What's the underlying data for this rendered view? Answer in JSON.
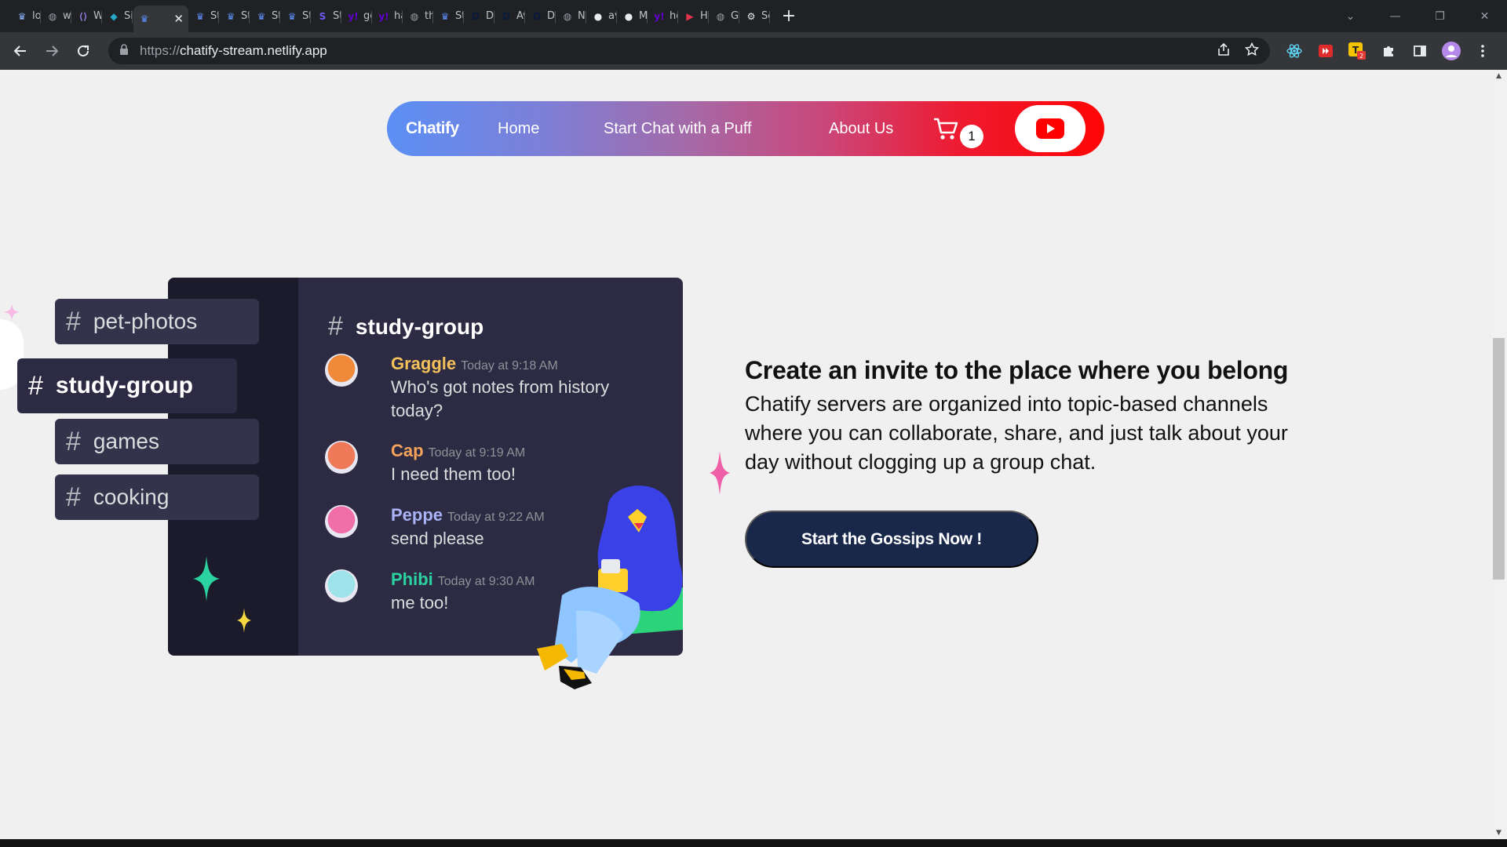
{
  "browser": {
    "tabs": [
      {
        "label": "lo",
        "icon": "crown-icon",
        "color": "#8ab4f8"
      },
      {
        "label": "wv",
        "icon": "globe-icon",
        "color": "#9aa0a6"
      },
      {
        "label": "W",
        "icon": "brackets-icon",
        "color": "#8a7bd8"
      },
      {
        "label": "Sit",
        "icon": "diamond-icon",
        "color": "#26a8c8"
      },
      {
        "label": "",
        "icon": "crown-icon",
        "color": "#5c8ff5",
        "active": true
      },
      {
        "label": "Str",
        "icon": "crown-icon",
        "color": "#5c8ff5"
      },
      {
        "label": "Str",
        "icon": "crown-icon",
        "color": "#5c8ff5"
      },
      {
        "label": "Str",
        "icon": "crown-icon",
        "color": "#5c8ff5"
      },
      {
        "label": "Str",
        "icon": "crown-icon",
        "color": "#5c8ff5"
      },
      {
        "label": "Str",
        "icon": "s-icon",
        "color": "#6f5af3"
      },
      {
        "label": "ge",
        "icon": "yahoo-icon",
        "color": "#6001d2"
      },
      {
        "label": "ha",
        "icon": "yahoo-icon",
        "color": "#6001d2"
      },
      {
        "label": "th",
        "icon": "globe-icon",
        "color": "#9aa0a6"
      },
      {
        "label": "Str",
        "icon": "crown-icon",
        "color": "#5c8ff5"
      },
      {
        "label": "De",
        "icon": "d-icon",
        "color": "#0a1a3a"
      },
      {
        "label": "Av",
        "icon": "d-icon",
        "color": "#0a1a3a"
      },
      {
        "label": "De",
        "icon": "d-icon",
        "color": "#0a1a3a"
      },
      {
        "label": "Ne",
        "icon": "globe-icon",
        "color": "#9aa0a6"
      },
      {
        "label": "av",
        "icon": "github-icon",
        "color": "#e8eaed"
      },
      {
        "label": "M",
        "icon": "github-icon",
        "color": "#e8eaed"
      },
      {
        "label": "ho",
        "icon": "yahoo-icon",
        "color": "#6001d2"
      },
      {
        "label": "Ho",
        "icon": "play-icon",
        "color": "#e8344e"
      },
      {
        "label": "Gi",
        "icon": "globe-icon",
        "color": "#9aa0a6"
      },
      {
        "label": "Se",
        "icon": "gear-icon",
        "color": "#e8eaed"
      }
    ],
    "close_glyph": "✕",
    "new_tab_glyph": "+",
    "window_controls": {
      "dropdown": "⌄",
      "minimize": "—",
      "maximize": "❐",
      "close": "✕"
    },
    "url_scheme": "https://",
    "url_host": "chatify-stream.netlify.app"
  },
  "navbar": {
    "brand": "Chatify",
    "links": [
      "Home",
      "Start Chat with a Puff",
      "About Us"
    ],
    "cart_count": "1"
  },
  "illustration": {
    "channels": [
      "pet-photos",
      "study-group",
      "games",
      "cooking"
    ],
    "active_channel": "study-group",
    "channel_title": "study-group",
    "messages": [
      {
        "name": "Graggle",
        "time": "Today at 9:18 AM",
        "text": "Who's got notes from history today?",
        "name_color": "#f5c15b",
        "avatar_color": "#f08a3a"
      },
      {
        "name": "Cap",
        "time": "Today at 9:19 AM",
        "text": "I need them too!",
        "name_color": "#f5a35b",
        "avatar_color": "#f0795a"
      },
      {
        "name": "Peppe",
        "time": "Today at 9:22 AM",
        "text": "send please",
        "name_color": "#a9b3f5",
        "avatar_color": "#f06fa8"
      },
      {
        "name": "Phibi",
        "time": "Today at 9:30 AM",
        "text": "me too!",
        "name_color": "#2bd3a0",
        "avatar_color": "#9fe3ea"
      }
    ]
  },
  "content": {
    "heading": "Create an invite to the place where you belong",
    "paragraph": "Chatify servers are organized into topic-based channels where you can collaborate, share, and just talk about your day without clogging up a group chat.",
    "cta": "Start the Gossips Now !"
  }
}
